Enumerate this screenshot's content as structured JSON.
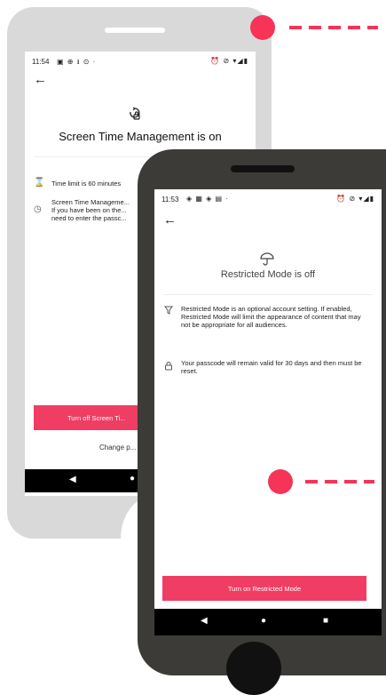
{
  "back_screen": {
    "status_time": "11:54",
    "status_icons_left": "▣ ⊕ ⭳ ⊙ ·",
    "status_icons_right": "⏰ ⊘ ▾◢▮",
    "title": "Screen Time Management is on",
    "rows": [
      {
        "icon": "hourglass-icon",
        "text": "Time limit is 60 minutes"
      },
      {
        "icon": "clock-icon",
        "text": "Screen Time Manageme...\nIf you have been on the...\nneed to enter the passc..."
      }
    ],
    "primary_button": "Turn off Screen Ti...",
    "secondary_link": "Change p..."
  },
  "front_screen": {
    "status_time": "11:53",
    "status_icons_left": "◈ ▦ ◈ ▤ ·",
    "status_icons_right": "⏰ ⊘ ▾◢▮",
    "title": "Restricted Mode is off",
    "rows": [
      {
        "icon": "filter-icon",
        "text": "Restricted Mode is an optional account setting. If enabled, Restricted Mode will limit the appearance of content that may not be appropriate for all audiences."
      },
      {
        "icon": "lock-icon",
        "text": "Your passcode will remain valid for 30 days and then must be reset."
      }
    ],
    "primary_button": "Turn on Restricted Mode"
  },
  "colors": {
    "accent": "#ef3d63",
    "callout": "#f53458",
    "frame_dark": "#3c3b37",
    "frame_light": "#d9d9d9"
  }
}
